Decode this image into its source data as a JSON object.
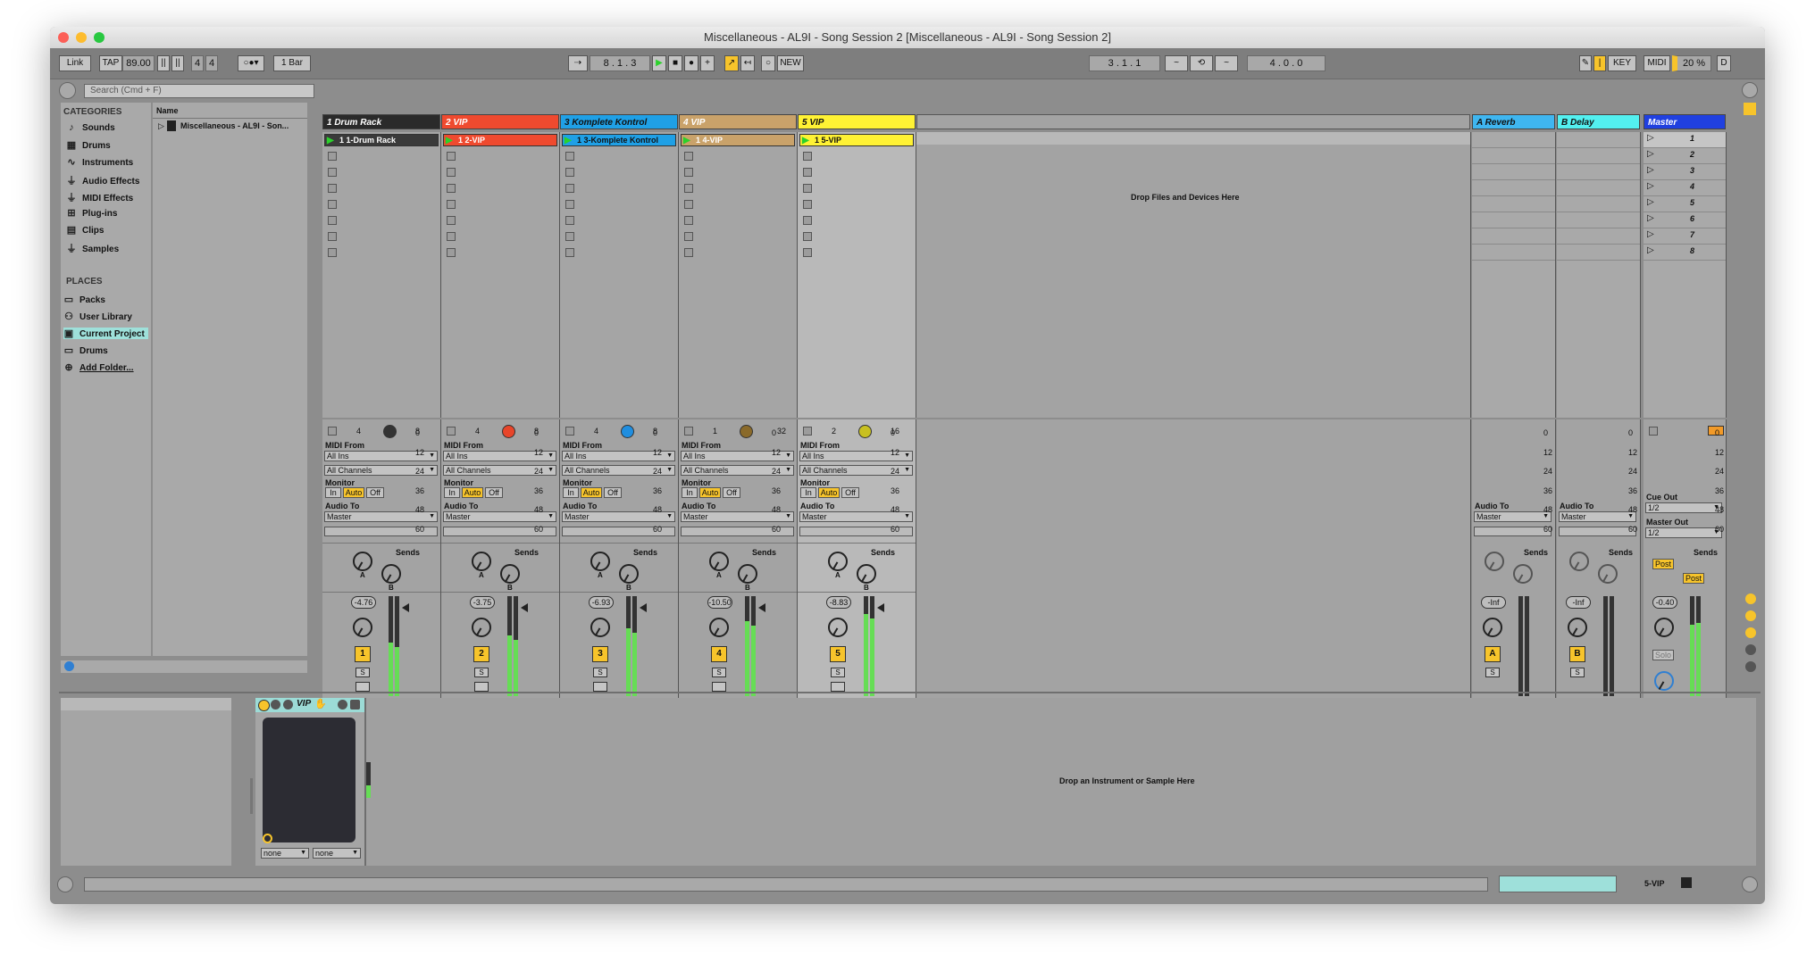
{
  "window": {
    "title": "Miscellaneous - AL9I - Song Session 2  [Miscellaneous - AL9I - Song Session 2]"
  },
  "control_bar": {
    "link": "Link",
    "tap": "TAP",
    "tempo": "89.00",
    "signature_num": "4",
    "signature_den": "4",
    "quantize": "1 Bar",
    "position": "8 .   1 .   3",
    "new": "NEW",
    "loop_start": "3 .   1 .   1",
    "loop_length": "4 .   0 .   0",
    "key": "KEY",
    "midi": "MIDI",
    "cpu": "20 %",
    "d": "D"
  },
  "browser": {
    "search_placeholder": "Search (Cmd + F)",
    "categories_title": "CATEGORIES",
    "categories": [
      "Sounds",
      "Drums",
      "Instruments",
      "Audio Effects",
      "MIDI Effects",
      "Plug-ins",
      "Clips",
      "Samples"
    ],
    "places_title": "PLACES",
    "places": [
      "Packs",
      "User Library",
      "Current Project",
      "Drums",
      "Add Folder..."
    ],
    "name_header": "Name",
    "file": "Miscellaneous - AL9I - Son..."
  },
  "tracks": [
    {
      "name": "1 Drum Rack",
      "clip": "1 1-Drum Rack",
      "color": "#2a2a2a",
      "clip_color": "#3a3a3a",
      "text_color": "#ffffff",
      "left_num": "4",
      "right_num": "8",
      "vol": "-4.76",
      "num": "1",
      "dot": "#333333"
    },
    {
      "name": "2 VIP",
      "clip": "1 2-VIP",
      "color": "#ef4a2f",
      "clip_color": "#ef4a2f",
      "text_color": "#ffffff",
      "left_num": "4",
      "right_num": "8",
      "vol": "-3.75",
      "num": "2",
      "dot": "#e8452a"
    },
    {
      "name": "3 Komplete Kontrol",
      "clip": "1 3-Komplete Kontrol",
      "color": "#1fa0e6",
      "clip_color": "#1fa0e6",
      "text_color": "#111111",
      "left_num": "4",
      "right_num": "8",
      "vol": "-6.93",
      "num": "3",
      "dot": "#1f8ee0"
    },
    {
      "name": "4 VIP",
      "clip": "1 4-VIP",
      "color": "#c9a26a",
      "clip_color": "#c9a26a",
      "text_color": "#ffffff",
      "left_num": "1",
      "right_num": "32",
      "vol": "-10.50",
      "num": "4",
      "dot": "#8a6a2a"
    },
    {
      "name": "5 VIP",
      "clip": "1 5-VIP",
      "color": "#fff234",
      "clip_color": "#fff234",
      "text_color": "#111111",
      "left_num": "2",
      "right_num": "16",
      "vol": "-8.83",
      "num": "5",
      "dot": "#c8c020"
    }
  ],
  "returns": [
    {
      "name": "A Reverb",
      "color": "#3fb6f0",
      "vol": "-Inf",
      "num": "A"
    },
    {
      "name": "B Delay",
      "color": "#53f0f0",
      "vol": "-Inf",
      "num": "B"
    }
  ],
  "master": {
    "name": "Master",
    "color": "#2040e0",
    "vol": "-0.40",
    "scenes": [
      "1",
      "2",
      "3",
      "4",
      "5",
      "6",
      "7",
      "8"
    ],
    "cue_out": "Cue Out",
    "cue_val": "1/2",
    "master_out": "Master Out",
    "master_val": "1/2",
    "post1": "Post",
    "post2": "Post",
    "solo": "Solo"
  },
  "io": {
    "midi_from": "MIDI From",
    "all_ins": "All Ins",
    "all_channels": "All Channels",
    "monitor": "Monitor",
    "in": "In",
    "auto": "Auto",
    "off": "Off",
    "audio_to": "Audio To",
    "master": "Master",
    "sends": "Sends",
    "send_a": "A",
    "send_b": "B",
    "solo_s": "S"
  },
  "drop_files": "Drop Files and Devices Here",
  "drop_instrument": "Drop an Instrument or Sample Here",
  "device": {
    "name": "VIP",
    "sel1": "none",
    "sel2": "none"
  },
  "meter_scale": [
    "0",
    "12",
    "24",
    "36",
    "48",
    "60"
  ],
  "status": {
    "track": "5-VIP"
  }
}
